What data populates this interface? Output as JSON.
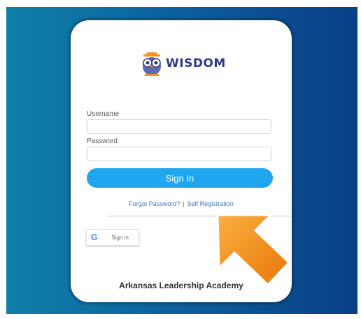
{
  "app": {
    "logo_text": "WISDOM",
    "logo_icon": "owl-icon"
  },
  "form": {
    "username_label": "Username",
    "username_value": "",
    "password_label": "Password",
    "password_value": "",
    "signin_label": "Sign In"
  },
  "links": {
    "forgot": "Forgot Password?",
    "separator": "|",
    "register": "Self Registration"
  },
  "google": {
    "icon": "google-icon",
    "label": "Sign in"
  },
  "footer": "Arkansas Leadership Academy",
  "colors": {
    "background_left": "#0e80a8",
    "background_right": "#0a3e86",
    "signin_button": "#1fa6ef",
    "link": "#3b78b8",
    "arrow": "#f7941d"
  }
}
